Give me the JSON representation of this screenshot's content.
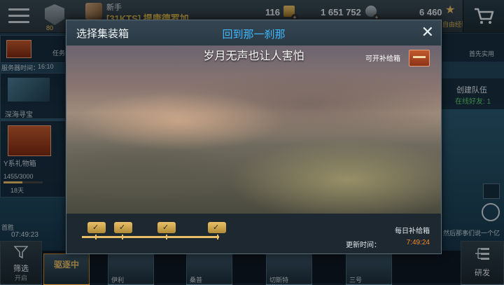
{
  "topbar": {
    "rank_sub": "80",
    "player_name": "新手",
    "player_clan": "[31KTS] 提康德罗加",
    "gold": "116",
    "credits": "1 651 752",
    "free_xp": "6 460",
    "free_xp_sub": "自由经验"
  },
  "left": {
    "tasks_label": "任务",
    "server_time_label": "服务器时间：",
    "server_time": "16:10",
    "deep_sea": "深海寻宝",
    "y_gift": "Y系礼物箱",
    "progress_text": "1455/3000",
    "days": "18天",
    "first_win": "首胜",
    "first_win_timer": "07:49:23"
  },
  "right": {
    "first_win_label": "首先实用",
    "create_team": "创建队伍",
    "online_friends": "在线好友: 1",
    "chat_hint": "然后那事们说一个亿"
  },
  "bottom": {
    "filter_label": "筛选",
    "filter_sub": "开启",
    "research_label": "研发",
    "ship_tag": "驱逐中",
    "ship_names": [
      "",
      "伊利",
      "桑普",
      "切斯特",
      "三号",
      ""
    ]
  },
  "modal": {
    "title": "选择集装箱",
    "subtitle": "回到那一刹那",
    "scene_caption": "岁月无声也让人害怕",
    "openable_label": "可开补给箱",
    "daily_label": "每日补给箱",
    "refresh_label": "更新时间：",
    "refresh_time": "7:49:24",
    "progress_nodes": [
      "✓",
      "✓",
      "✓",
      "✓"
    ],
    "progress_fraction": 1.0
  },
  "colors": {
    "accent_blue": "#3fb7ff",
    "gold": "#e9c067",
    "timer_orange": "#f08a2a"
  }
}
